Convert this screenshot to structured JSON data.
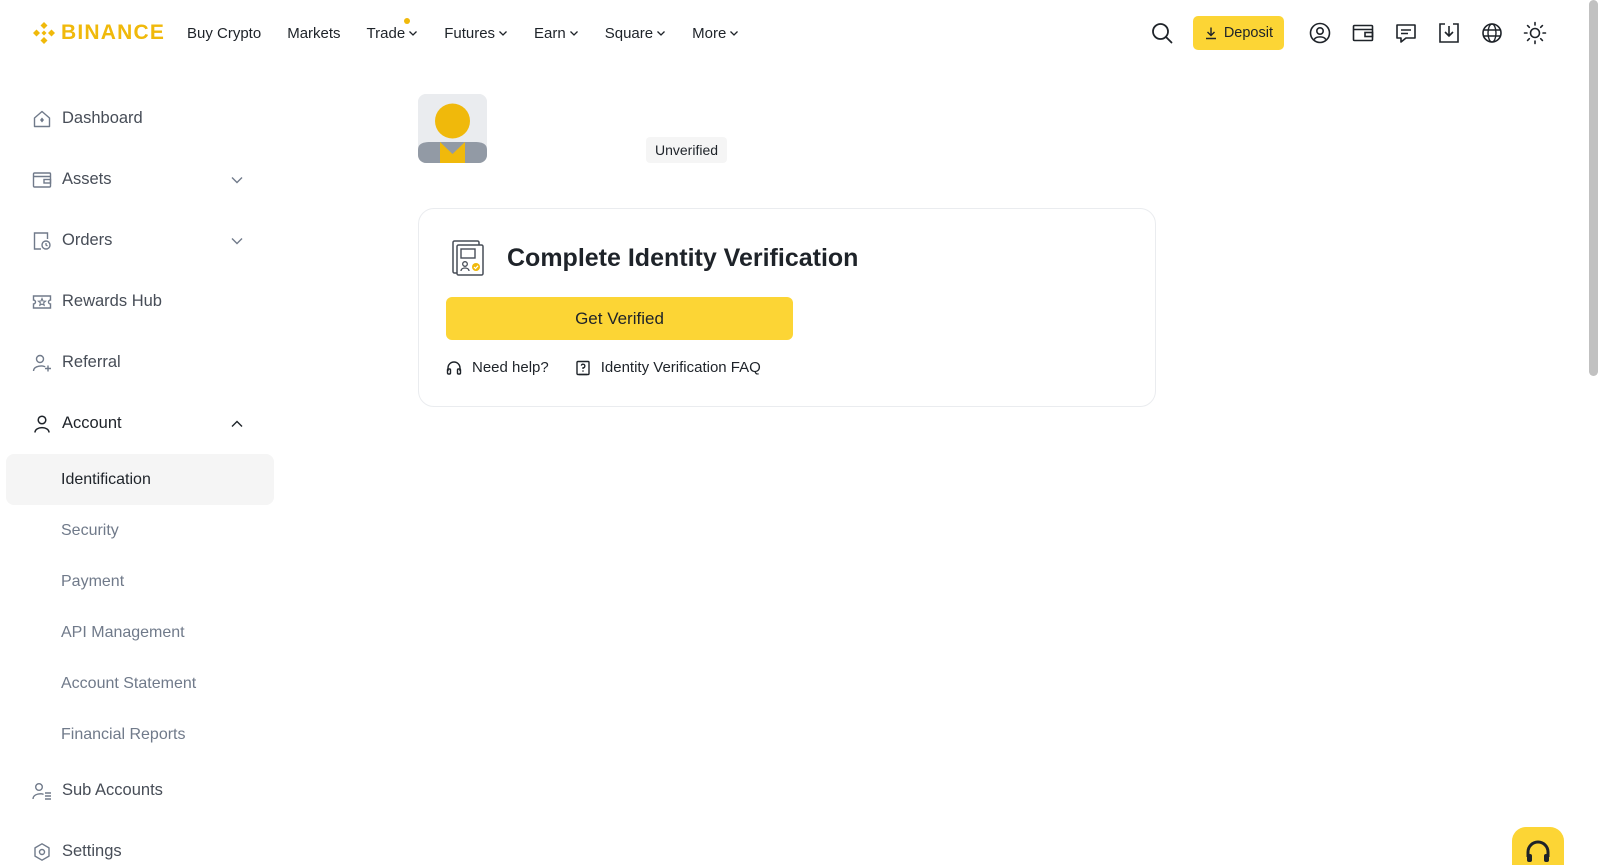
{
  "brand": {
    "name": "BINANCE",
    "color": "#f0b90b",
    "icon": "binance-logo-icon"
  },
  "nav": {
    "items": [
      {
        "label": "Buy Crypto",
        "has_dropdown": false
      },
      {
        "label": "Markets",
        "has_dropdown": false
      },
      {
        "label": "Trade",
        "has_dropdown": true,
        "has_dot": true
      },
      {
        "label": "Futures",
        "has_dropdown": true
      },
      {
        "label": "Earn",
        "has_dropdown": true
      },
      {
        "label": "Square",
        "has_dropdown": true
      },
      {
        "label": "More",
        "has_dropdown": true
      }
    ]
  },
  "header_actions": {
    "search_icon": "search-icon",
    "deposit_label": "Deposit",
    "icons": [
      "profile-icon",
      "wallet-icon",
      "messages-icon",
      "download-icon",
      "globe-icon",
      "theme-icon"
    ]
  },
  "sidebar": {
    "items": [
      {
        "label": "Dashboard",
        "icon": "home-icon"
      },
      {
        "label": "Assets",
        "icon": "wallet-icon",
        "expandable": true
      },
      {
        "label": "Orders",
        "icon": "orders-icon",
        "expandable": true
      },
      {
        "label": "Rewards Hub",
        "icon": "ticket-icon"
      },
      {
        "label": "Referral",
        "icon": "add-user-icon"
      },
      {
        "label": "Account",
        "icon": "user-icon",
        "expanded": true
      },
      {
        "label": "Sub Accounts",
        "icon": "sub-accounts-icon"
      },
      {
        "label": "Settings",
        "icon": "settings-icon"
      }
    ],
    "account_children": [
      {
        "label": "Identification",
        "active": true
      },
      {
        "label": "Security"
      },
      {
        "label": "Payment"
      },
      {
        "label": "API Management"
      },
      {
        "label": "Account Statement"
      },
      {
        "label": "Financial Reports"
      }
    ]
  },
  "profile": {
    "status_badge": "Unverified"
  },
  "verification_card": {
    "title": "Complete Identity Verification",
    "button_label": "Get Verified",
    "help_link": "Need help?",
    "faq_link": "Identity Verification FAQ"
  },
  "colors": {
    "accent": "#fcd535",
    "text": "#1e2329",
    "muted": "#707a8a",
    "border": "#eaecef"
  }
}
